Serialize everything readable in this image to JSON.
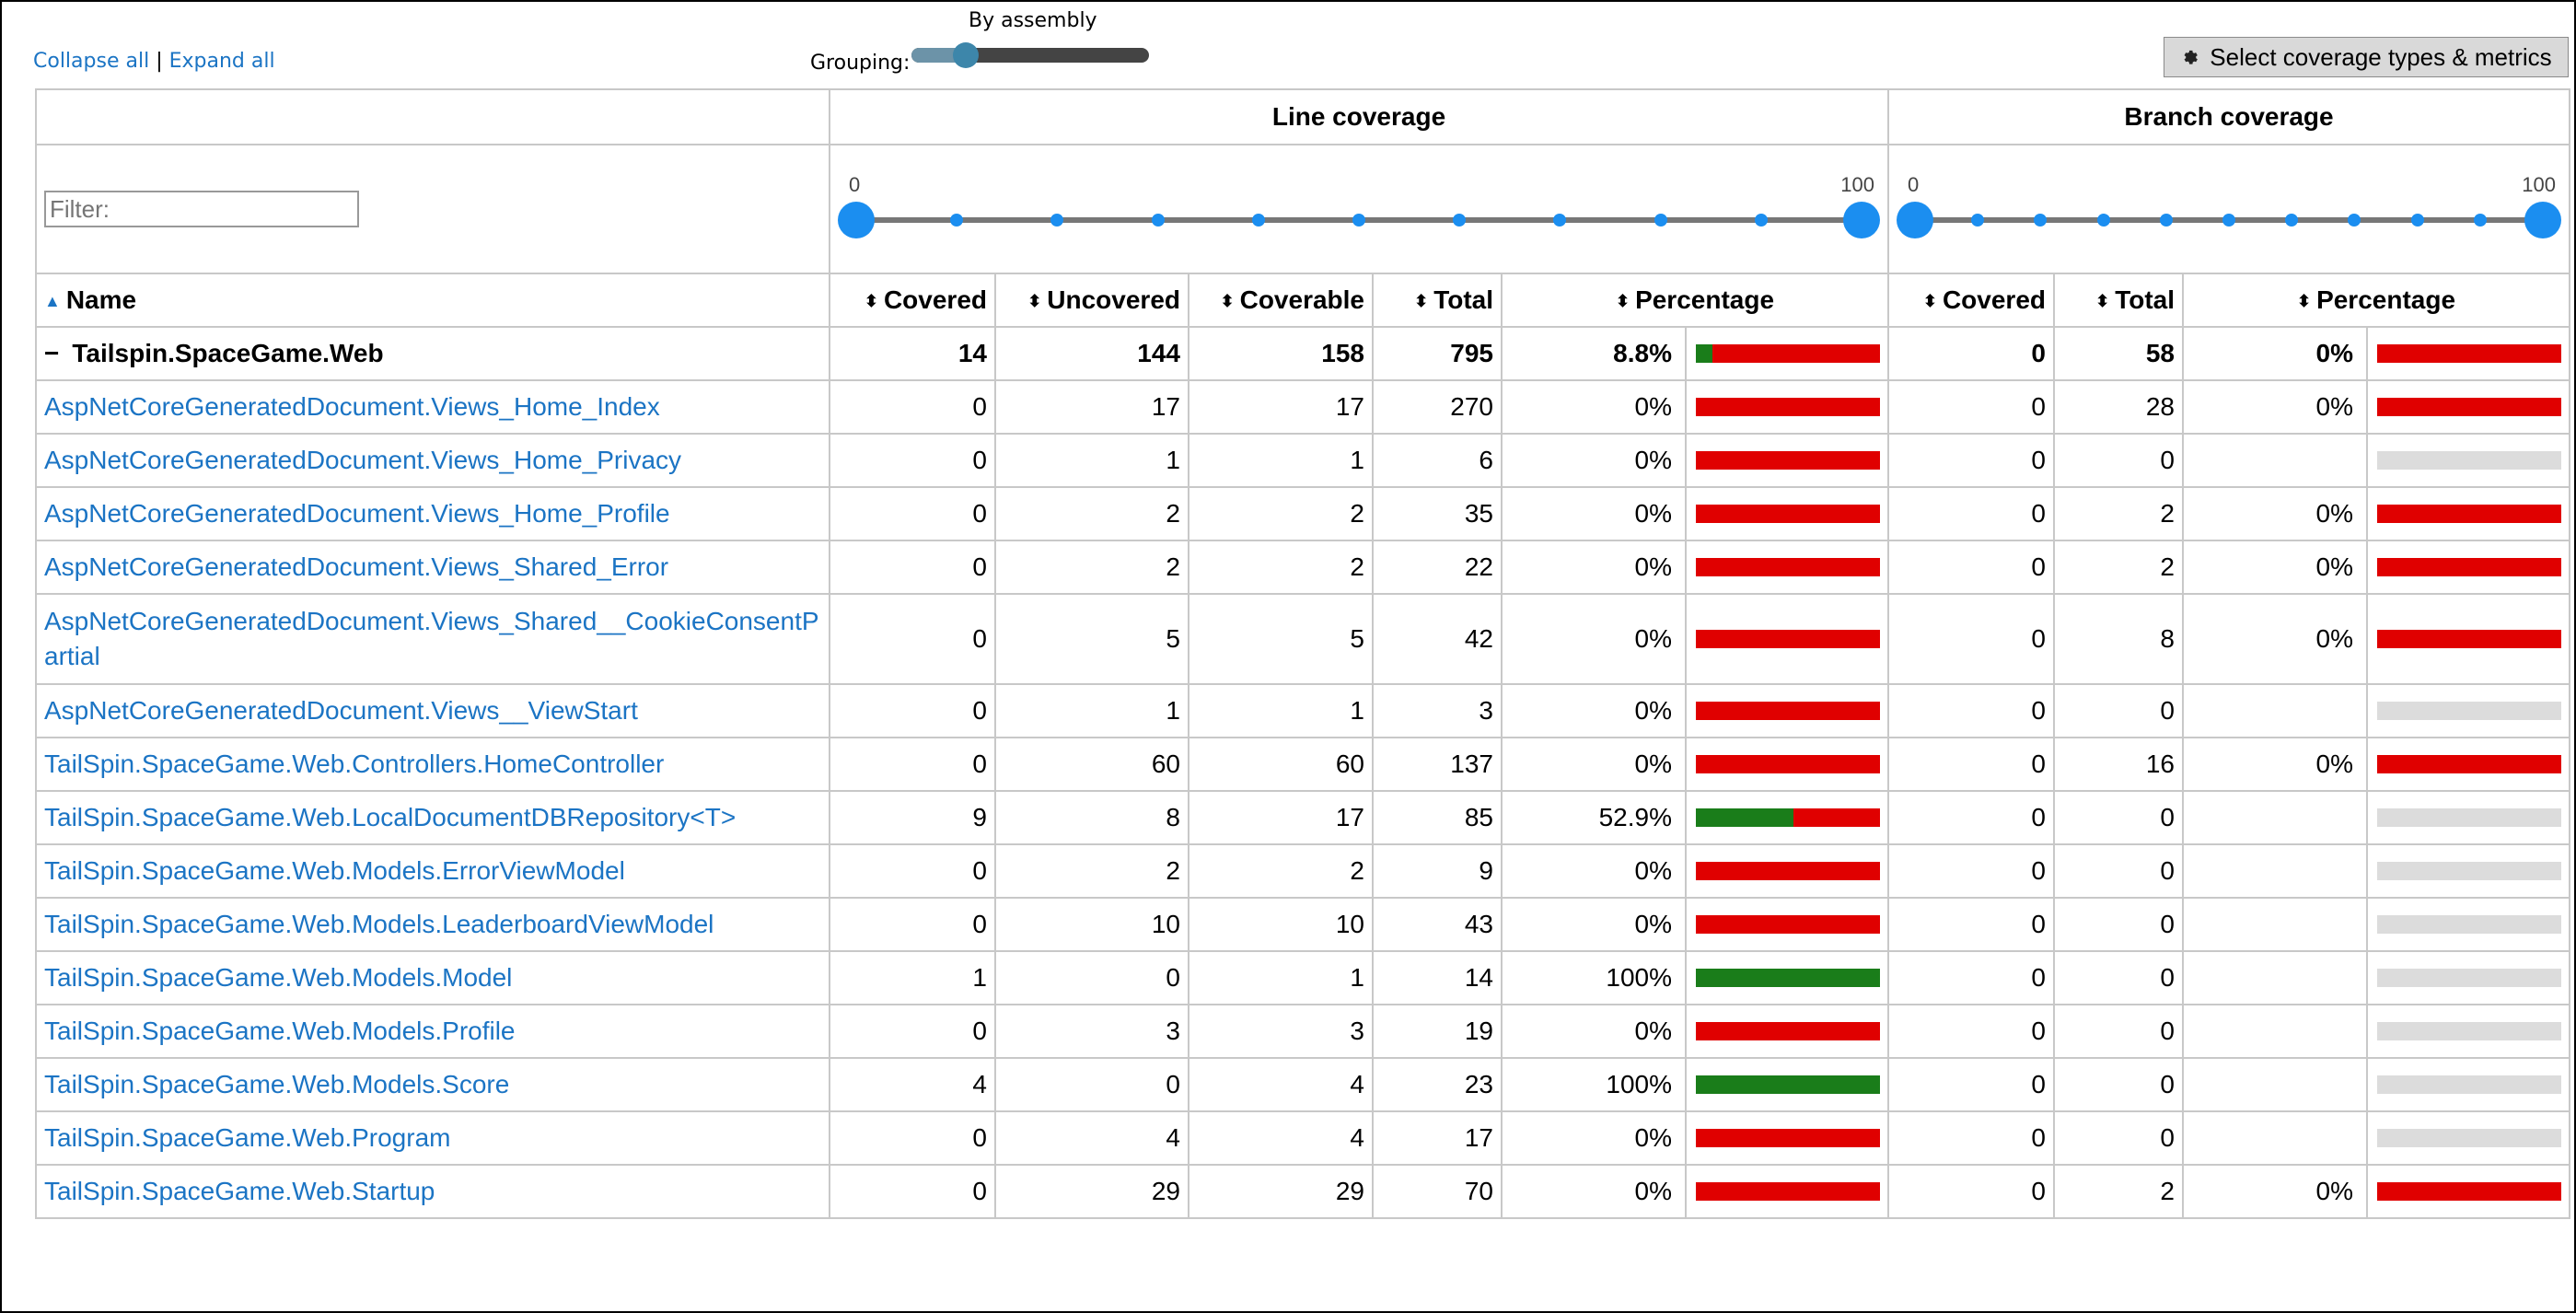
{
  "toolbar": {
    "collapse_all": "Collapse all",
    "separator": "|",
    "expand_all": "Expand all",
    "grouping_label": "Grouping:",
    "grouping_value": "By assembly",
    "metrics_button": "Select coverage types & metrics"
  },
  "filter": {
    "placeholder": "Filter:"
  },
  "groups": {
    "line": "Line coverage",
    "branch": "Branch coverage"
  },
  "line_slider": {
    "min": "0",
    "max": "100"
  },
  "branch_slider": {
    "min": "0",
    "max": "100"
  },
  "columns": {
    "name": "Name",
    "line_covered": "Covered",
    "line_uncovered": "Uncovered",
    "line_coverable": "Coverable",
    "line_total": "Total",
    "line_percentage": "Percentage",
    "branch_covered": "Covered",
    "branch_total": "Total",
    "branch_percentage": "Percentage"
  },
  "colors": {
    "covered": "#1a7d1a",
    "uncovered": "#e00000",
    "empty": "#dcdcdc",
    "link": "#1b74c4"
  },
  "assembly": {
    "toggle": "−",
    "name": "Tailspin.SpaceGame.Web",
    "covered": "14",
    "uncovered": "144",
    "coverable": "158",
    "total": "795",
    "percentage": "8.8%",
    "line_pct": 8.8,
    "branch_covered": "0",
    "branch_total": "58",
    "branch_percentage": "0%",
    "branch_pct": 0
  },
  "rows": [
    {
      "name": "AspNetCoreGeneratedDocument.Views_Home_Index",
      "covered": "0",
      "uncovered": "17",
      "coverable": "17",
      "total": "270",
      "percentage": "0%",
      "line_pct": 0,
      "branch_covered": "0",
      "branch_total": "28",
      "branch_percentage": "0%",
      "branch_pct": 0
    },
    {
      "name": "AspNetCoreGeneratedDocument.Views_Home_Privacy",
      "covered": "0",
      "uncovered": "1",
      "coverable": "1",
      "total": "6",
      "percentage": "0%",
      "line_pct": 0,
      "branch_covered": "0",
      "branch_total": "0",
      "branch_percentage": "",
      "branch_pct": null
    },
    {
      "name": "AspNetCoreGeneratedDocument.Views_Home_Profile",
      "covered": "0",
      "uncovered": "2",
      "coverable": "2",
      "total": "35",
      "percentage": "0%",
      "line_pct": 0,
      "branch_covered": "0",
      "branch_total": "2",
      "branch_percentage": "0%",
      "branch_pct": 0
    },
    {
      "name": "AspNetCoreGeneratedDocument.Views_Shared_Error",
      "covered": "0",
      "uncovered": "2",
      "coverable": "2",
      "total": "22",
      "percentage": "0%",
      "line_pct": 0,
      "branch_covered": "0",
      "branch_total": "2",
      "branch_percentage": "0%",
      "branch_pct": 0
    },
    {
      "name": "AspNetCoreGeneratedDocument.Views_Shared__CookieConsentPartial",
      "covered": "0",
      "uncovered": "5",
      "coverable": "5",
      "total": "42",
      "percentage": "0%",
      "line_pct": 0,
      "branch_covered": "0",
      "branch_total": "8",
      "branch_percentage": "0%",
      "branch_pct": 0
    },
    {
      "name": "AspNetCoreGeneratedDocument.Views__ViewStart",
      "covered": "0",
      "uncovered": "1",
      "coverable": "1",
      "total": "3",
      "percentage": "0%",
      "line_pct": 0,
      "branch_covered": "0",
      "branch_total": "0",
      "branch_percentage": "",
      "branch_pct": null
    },
    {
      "name": "TailSpin.SpaceGame.Web.Controllers.HomeController",
      "covered": "0",
      "uncovered": "60",
      "coverable": "60",
      "total": "137",
      "percentage": "0%",
      "line_pct": 0,
      "branch_covered": "0",
      "branch_total": "16",
      "branch_percentage": "0%",
      "branch_pct": 0
    },
    {
      "name": "TailSpin.SpaceGame.Web.LocalDocumentDBRepository<T>",
      "covered": "9",
      "uncovered": "8",
      "coverable": "17",
      "total": "85",
      "percentage": "52.9%",
      "line_pct": 52.9,
      "branch_covered": "0",
      "branch_total": "0",
      "branch_percentage": "",
      "branch_pct": null
    },
    {
      "name": "TailSpin.SpaceGame.Web.Models.ErrorViewModel",
      "covered": "0",
      "uncovered": "2",
      "coverable": "2",
      "total": "9",
      "percentage": "0%",
      "line_pct": 0,
      "branch_covered": "0",
      "branch_total": "0",
      "branch_percentage": "",
      "branch_pct": null
    },
    {
      "name": "TailSpin.SpaceGame.Web.Models.LeaderboardViewModel",
      "covered": "0",
      "uncovered": "10",
      "coverable": "10",
      "total": "43",
      "percentage": "0%",
      "line_pct": 0,
      "branch_covered": "0",
      "branch_total": "0",
      "branch_percentage": "",
      "branch_pct": null
    },
    {
      "name": "TailSpin.SpaceGame.Web.Models.Model",
      "covered": "1",
      "uncovered": "0",
      "coverable": "1",
      "total": "14",
      "percentage": "100%",
      "line_pct": 100,
      "branch_covered": "0",
      "branch_total": "0",
      "branch_percentage": "",
      "branch_pct": null
    },
    {
      "name": "TailSpin.SpaceGame.Web.Models.Profile",
      "covered": "0",
      "uncovered": "3",
      "coverable": "3",
      "total": "19",
      "percentage": "0%",
      "line_pct": 0,
      "branch_covered": "0",
      "branch_total": "0",
      "branch_percentage": "",
      "branch_pct": null
    },
    {
      "name": "TailSpin.SpaceGame.Web.Models.Score",
      "covered": "4",
      "uncovered": "0",
      "coverable": "4",
      "total": "23",
      "percentage": "100%",
      "line_pct": 100,
      "branch_covered": "0",
      "branch_total": "0",
      "branch_percentage": "",
      "branch_pct": null
    },
    {
      "name": "TailSpin.SpaceGame.Web.Program",
      "covered": "0",
      "uncovered": "4",
      "coverable": "4",
      "total": "17",
      "percentage": "0%",
      "line_pct": 0,
      "branch_covered": "0",
      "branch_total": "0",
      "branch_percentage": "",
      "branch_pct": null
    },
    {
      "name": "TailSpin.SpaceGame.Web.Startup",
      "covered": "0",
      "uncovered": "29",
      "coverable": "29",
      "total": "70",
      "percentage": "0%",
      "line_pct": 0,
      "branch_covered": "0",
      "branch_total": "2",
      "branch_percentage": "0%",
      "branch_pct": 0
    }
  ]
}
